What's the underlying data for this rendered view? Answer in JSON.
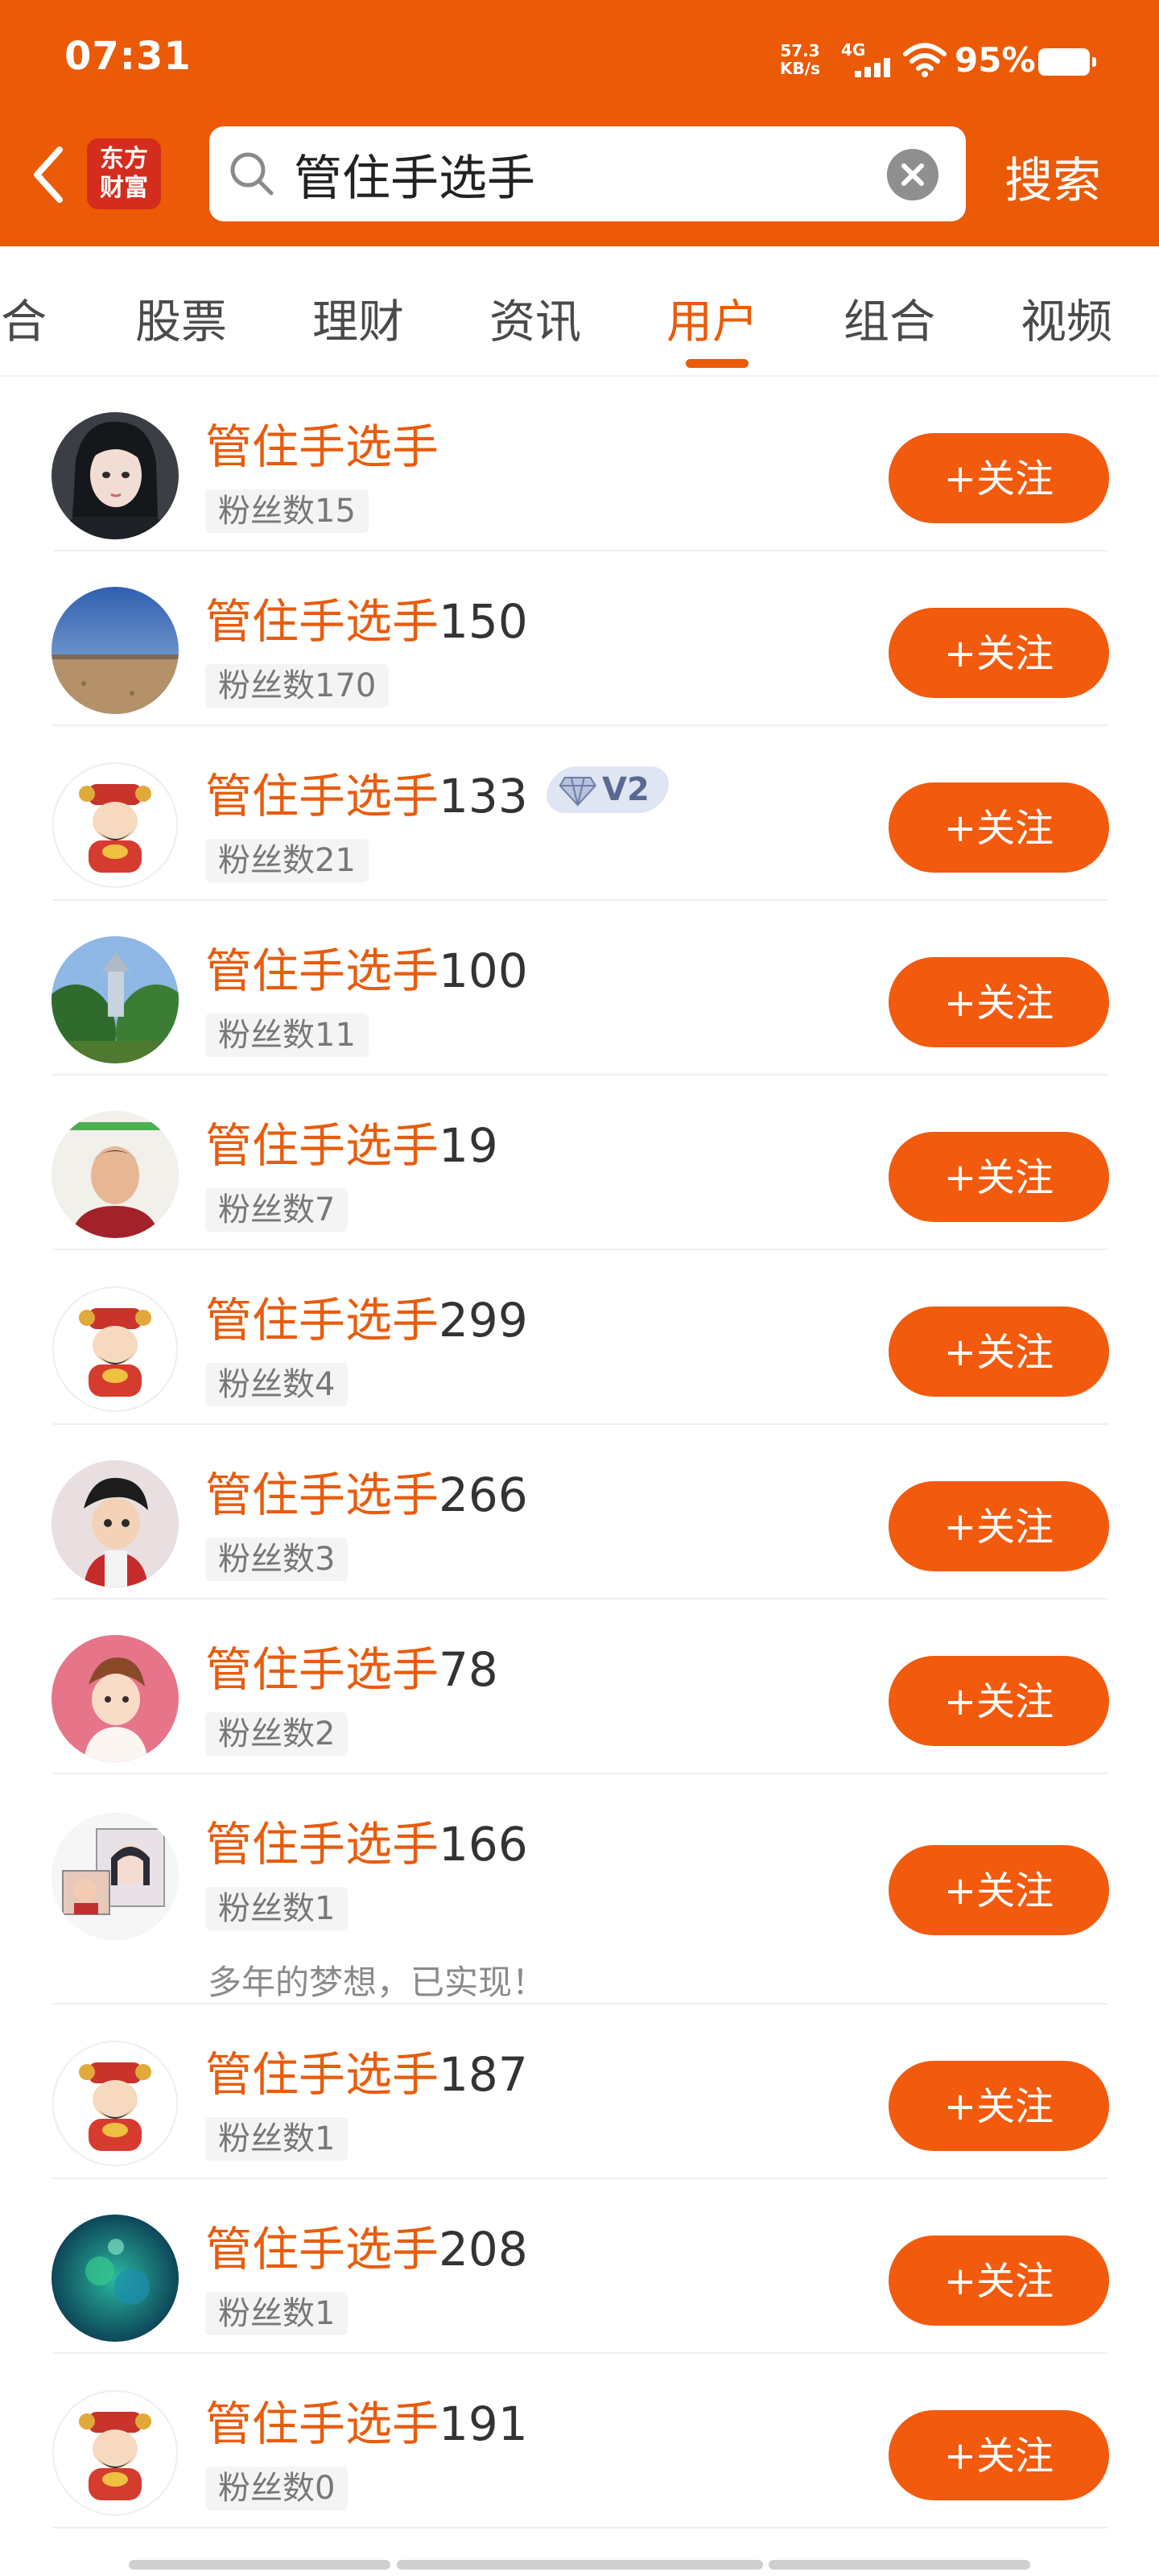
{
  "status_bar": {
    "time": "07:31",
    "net_speed_value": "57.3",
    "net_speed_unit": "KB/s",
    "network_type": "4G",
    "battery_percent": "95%"
  },
  "header": {
    "logo_line1": "东方",
    "logo_line2": "财富",
    "search_value": "管住手选手",
    "search_button": "搜索"
  },
  "tabs": [
    "综合",
    "股票",
    "理财",
    "资讯",
    "用户",
    "组合",
    "视频"
  ],
  "active_tab": "用户",
  "users": [
    {
      "name_highlight": "管住手选手",
      "name_suffix": "",
      "fans": "粉丝数15",
      "follow": "+关注",
      "avatar": "anime-girl-avatar"
    },
    {
      "name_highlight": "管住手选手",
      "name_suffix": "150",
      "fans": "粉丝数170",
      "follow": "+关注",
      "avatar": "desert-sky-avatar"
    },
    {
      "name_highlight": "管住手选手",
      "name_suffix": "133",
      "badge": "V2",
      "fans": "粉丝数21",
      "follow": "+关注",
      "avatar": "fortune-god-avatar"
    },
    {
      "name_highlight": "管住手选手",
      "name_suffix": "100",
      "fans": "粉丝数11",
      "follow": "+关注",
      "avatar": "temple-landscape-avatar"
    },
    {
      "name_highlight": "管住手选手",
      "name_suffix": "19",
      "fans": "粉丝数7",
      "follow": "+关注",
      "avatar": "man-photo-avatar"
    },
    {
      "name_highlight": "管住手选手",
      "name_suffix": "299",
      "fans": "粉丝数4",
      "follow": "+关注",
      "avatar": "fortune-god-avatar"
    },
    {
      "name_highlight": "管住手选手",
      "name_suffix": "266",
      "fans": "粉丝数3",
      "follow": "+关注",
      "avatar": "cartoon-boy-avatar"
    },
    {
      "name_highlight": "管住手选手",
      "name_suffix": "78",
      "fans": "粉丝数2",
      "follow": "+关注",
      "avatar": "cartoon-child-pink-avatar"
    },
    {
      "name_highlight": "管住手选手",
      "name_suffix": "166",
      "fans": "粉丝数1",
      "bio": "多年的梦想，已实现！",
      "follow": "+关注",
      "avatar": "sketch-photo-avatar"
    },
    {
      "name_highlight": "管住手选手",
      "name_suffix": "187",
      "fans": "粉丝数1",
      "follow": "+关注",
      "avatar": "fortune-god-avatar"
    },
    {
      "name_highlight": "管住手选手",
      "name_suffix": "208",
      "fans": "粉丝数1",
      "follow": "+关注",
      "avatar": "underwater-avatar"
    },
    {
      "name_highlight": "管住手选手",
      "name_suffix": "191",
      "fans": "粉丝数0",
      "follow": "+关注",
      "avatar": "fortune-god-avatar"
    }
  ],
  "colors": {
    "brand_orange": "#EB5A07",
    "button_orange": "#F25A0D",
    "highlight_text": "#E85C0D"
  }
}
